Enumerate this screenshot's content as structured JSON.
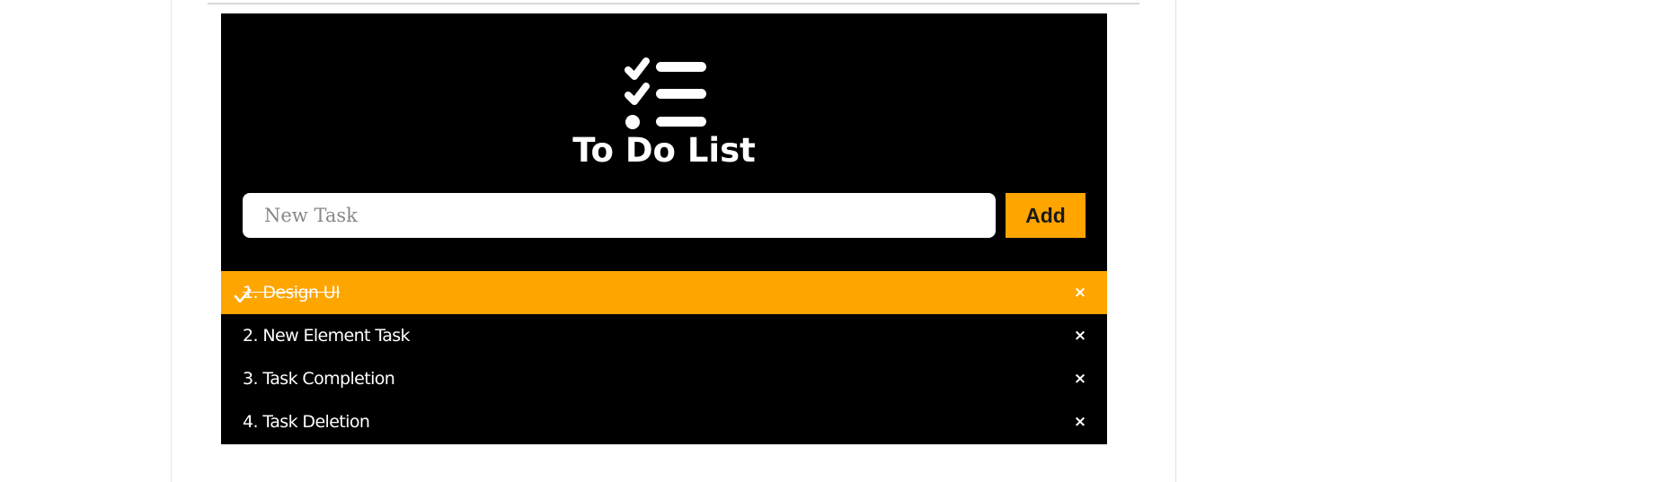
{
  "app": {
    "title": "To Do List",
    "logo_icon": "checklist-icon"
  },
  "input": {
    "placeholder": "New Task",
    "value": ""
  },
  "add_button": {
    "label": "Add"
  },
  "tasks": [
    {
      "label": "1. Design UI",
      "checked": true,
      "close_label": "×"
    },
    {
      "label": "2. New Element Task",
      "checked": false,
      "close_label": "×"
    },
    {
      "label": "3. Task Completion",
      "checked": false,
      "close_label": "×"
    },
    {
      "label": "4. Task Deletion",
      "checked": false,
      "close_label": "×"
    }
  ],
  "colors": {
    "accent": "#ffa500",
    "app_background": "#000000",
    "text": "#ffffff",
    "page_background": "#ffffff"
  }
}
